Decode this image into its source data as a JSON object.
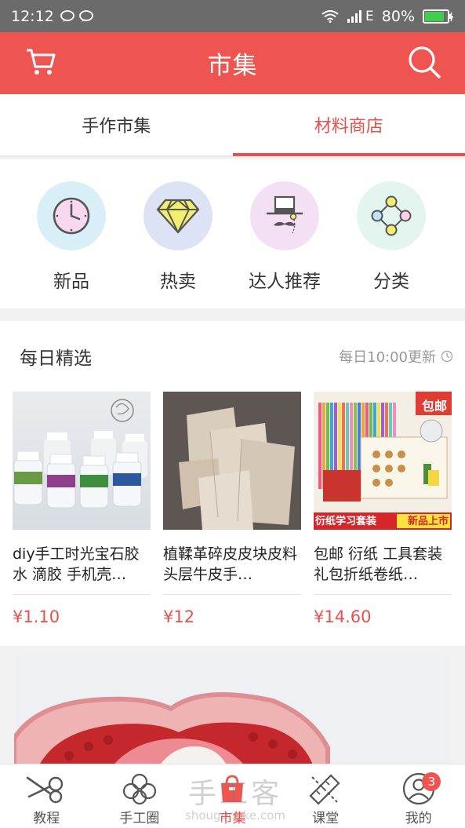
{
  "status_bar": {
    "time": "12:12",
    "network": "E",
    "battery": "80%"
  },
  "header": {
    "title": "市集",
    "cart_icon": "cart-icon",
    "search_icon": "search-icon"
  },
  "tabs": [
    {
      "label": "手作市集",
      "active": false
    },
    {
      "label": "材料商店",
      "active": true
    }
  ],
  "categories": [
    {
      "label": "新品",
      "icon": "clock-icon",
      "bg": "#d9eff8"
    },
    {
      "label": "热卖",
      "icon": "diamond-icon",
      "bg": "#dde3f5"
    },
    {
      "label": "达人推荐",
      "icon": "gentleman-icon",
      "bg": "#f4e0f5"
    },
    {
      "label": "分类",
      "icon": "nodes-icon",
      "bg": "#e4f4ee"
    }
  ],
  "daily": {
    "title": "每日精选",
    "update_text": "每日10:00更新",
    "products": [
      {
        "name": "diy手工时光宝石胶水 滴胶 手机壳…",
        "price": "¥1.10"
      },
      {
        "name": "植鞣革碎皮皮块皮料头层牛皮手…",
        "price": "¥12"
      },
      {
        "name": "包邮 衍纸 工具套装 礼包折纸卷纸…",
        "price": "¥14.60",
        "tag": "包邮",
        "strip_left": "衍纸学习套装",
        "strip_right": "新品上市"
      }
    ]
  },
  "bottom_nav": [
    {
      "label": "教程",
      "icon": "scissors-icon",
      "active": false
    },
    {
      "label": "手工圈",
      "icon": "flower-icon",
      "active": false
    },
    {
      "label": "市集",
      "icon": "bag-icon",
      "active": true
    },
    {
      "label": "课堂",
      "icon": "ruler-pencil-icon",
      "active": false
    },
    {
      "label": "我的",
      "icon": "profile-icon",
      "active": false,
      "badge": "3"
    }
  ],
  "watermark": {
    "main": "手工客",
    "sub": "shougongke.com"
  },
  "colors": {
    "brand": "#ee5550",
    "price": "#e8504b"
  }
}
